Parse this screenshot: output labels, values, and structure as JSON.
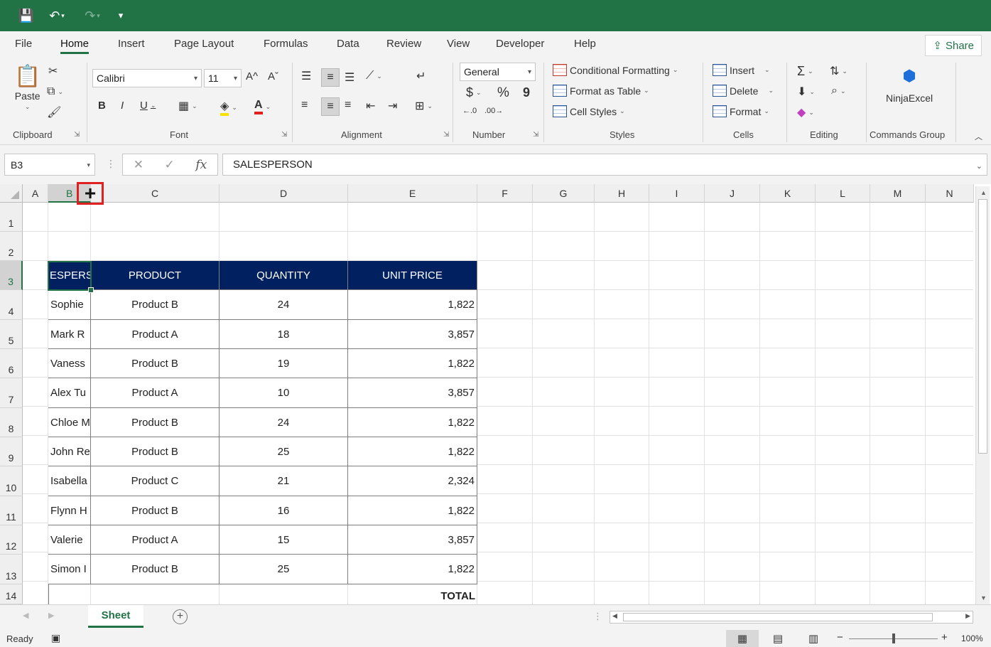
{
  "qat": {
    "save": "💾",
    "undo": "↶",
    "redo": "↷",
    "customize": "▾"
  },
  "tabs": [
    "File",
    "Home",
    "Insert",
    "Page Layout",
    "Formulas",
    "Data",
    "Review",
    "View",
    "Developer",
    "Help"
  ],
  "share_label": "Share",
  "ribbon": {
    "clipboard": {
      "label": "Clipboard",
      "paste": "Paste"
    },
    "font": {
      "label": "Font",
      "name": "Calibri",
      "size": "11",
      "bold": "B",
      "italic": "I",
      "underline": "U",
      "grow": "A^",
      "shrink": "Aˇ"
    },
    "alignment": {
      "label": "Alignment"
    },
    "number": {
      "label": "Number",
      "format": "General",
      "currency": "$",
      "percent": "%",
      "comma": "9"
    },
    "styles": {
      "label": "Styles",
      "conditional": "Conditional Formatting",
      "format_table": "Format as Table",
      "cell_styles": "Cell Styles"
    },
    "cells": {
      "label": "Cells",
      "insert": "Insert",
      "delete": "Delete",
      "format": "Format"
    },
    "editing": {
      "label": "Editing"
    },
    "commands": {
      "label": "Commands Group",
      "ninja": "NinjaExcel"
    }
  },
  "formula_bar": {
    "name_box": "B3",
    "cancel": "✕",
    "enter": "✓",
    "fx": "fx",
    "content": "SALESPERSON"
  },
  "columns": [
    "A",
    "B",
    "C",
    "D",
    "E",
    "F",
    "G",
    "H",
    "I",
    "J",
    "K",
    "L",
    "M",
    "N"
  ],
  "rows": [
    "1",
    "2",
    "3",
    "4",
    "5",
    "6",
    "7",
    "8",
    "9",
    "10",
    "11",
    "12",
    "13",
    "14"
  ],
  "table": {
    "headers": [
      "ESPERS",
      "PRODUCT",
      "QUANTITY",
      "UNIT PRICE"
    ],
    "rows": [
      [
        "Sophie",
        "Product B",
        "24",
        "1,822"
      ],
      [
        "Mark R",
        "Product A",
        "18",
        "3,857"
      ],
      [
        "Vaness",
        "Product B",
        "19",
        "1,822"
      ],
      [
        "Alex Tu",
        "Product A",
        "10",
        "3,857"
      ],
      [
        "Chloe M",
        "Product B",
        "24",
        "1,822"
      ],
      [
        "John Re",
        "Product B",
        "25",
        "1,822"
      ],
      [
        "Isabella",
        "Product C",
        "21",
        "2,324"
      ],
      [
        "Flynn H",
        "Product B",
        "16",
        "1,822"
      ],
      [
        "Valerie",
        "Product A",
        "15",
        "3,857"
      ],
      [
        "Simon I",
        "Product B",
        "25",
        "1,822"
      ]
    ],
    "total_label": "TOTAL"
  },
  "sheet_tab": "Sheet",
  "status": {
    "ready": "Ready",
    "zoom": "100%"
  },
  "colors": {
    "excel_green": "#217346",
    "header_fill": "#002060",
    "cursor_highlight": "#e02020"
  }
}
